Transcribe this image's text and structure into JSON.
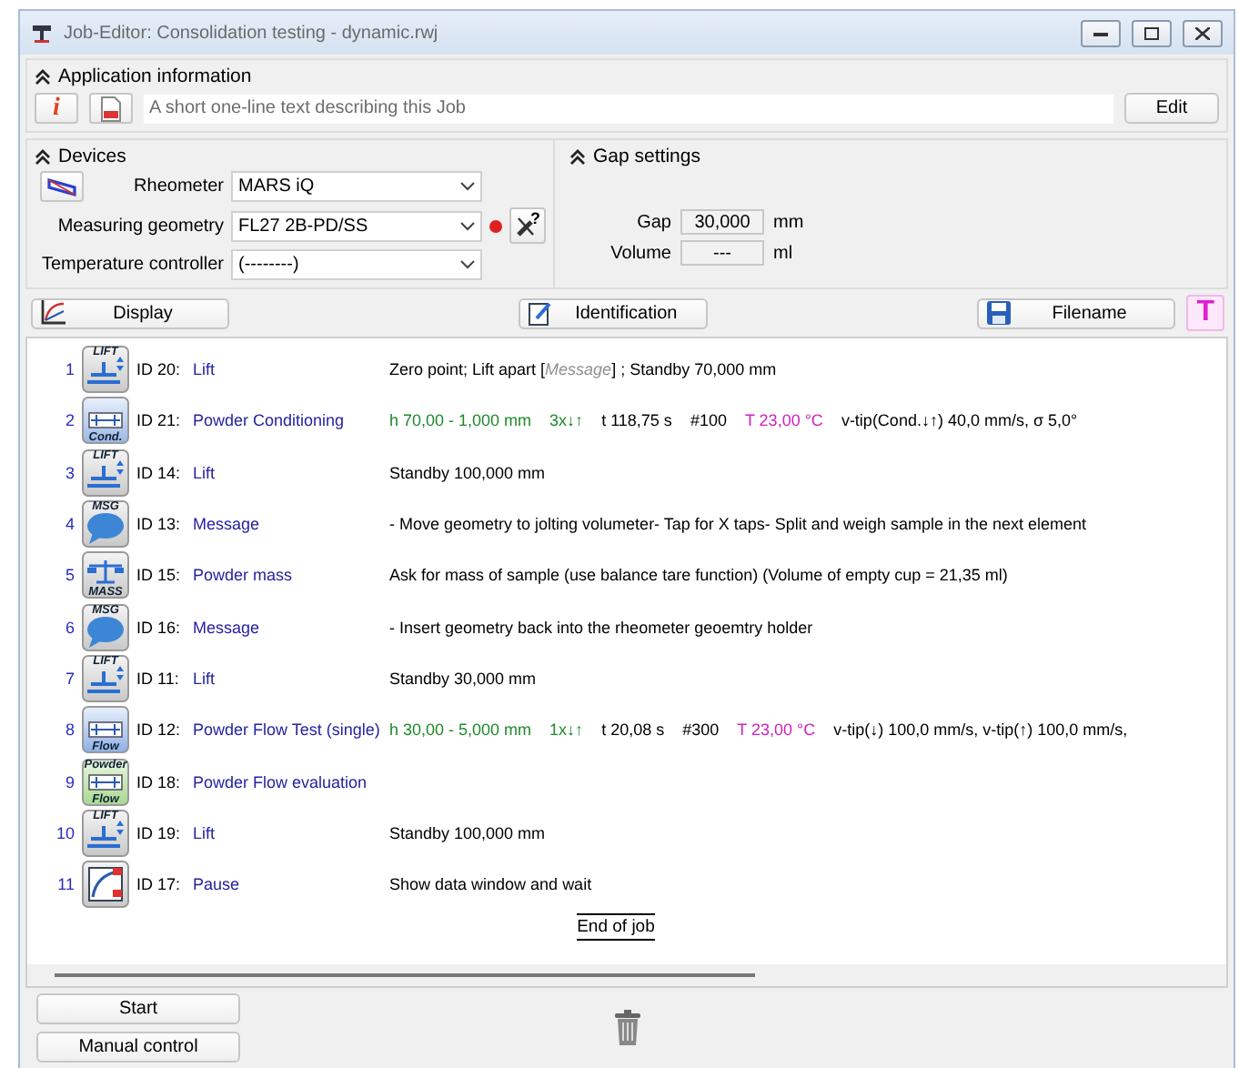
{
  "window": {
    "title": "Job-Editor: Consolidation testing - dynamic.rwj"
  },
  "application_information": {
    "header": "Application information",
    "info_button": "i",
    "description": "A short one-line text describing this Job",
    "edit_button": "Edit"
  },
  "devices": {
    "header": "Devices",
    "geometry_help_button": "?",
    "fields": [
      {
        "label": "Rheometer",
        "value": "MARS iQ"
      },
      {
        "label": "Measuring geometry",
        "value": "FL27 2B-PD/SS"
      },
      {
        "label": "Temperature controller",
        "value": "(--------)"
      }
    ]
  },
  "gap_settings": {
    "header": "Gap settings",
    "fields": [
      {
        "label": "Gap",
        "value": "30,000",
        "unit": "mm"
      },
      {
        "label": "Volume",
        "value": "---",
        "unit": "ml"
      }
    ]
  },
  "toolbar": {
    "buttons": [
      {
        "kind": "display",
        "label": "Display"
      },
      {
        "kind": "identification",
        "label": "Identification"
      },
      {
        "kind": "filename",
        "label": "Filename"
      }
    ],
    "font_button": "T"
  },
  "steps": [
    {
      "number": "1",
      "kind": "lift",
      "icon_text": [
        "LIFT"
      ],
      "id": "ID 20:",
      "name": "Lift",
      "details": [
        {
          "kind": "text",
          "text": "Zero point; Lift apart [",
          "color": "#000000"
        },
        {
          "kind": "hint",
          "text": "Message",
          "color": "#909090"
        },
        {
          "kind": "text",
          "text": "] ; Standby 70,000 mm",
          "color": "#000000"
        }
      ]
    },
    {
      "number": "2",
      "kind": "cond",
      "icon_text": [
        "Cond."
      ],
      "id": "ID 21:",
      "name": "Powder Conditioning",
      "details": [
        {
          "kind": "param",
          "text": "h 70,00 - 1,000 mm",
          "color": "#1e8a2a"
        },
        {
          "kind": "param",
          "text": "3x↓↑",
          "color": "#1e8a2a"
        },
        {
          "kind": "param",
          "text": "t 118,75 s",
          "color": "#000000"
        },
        {
          "kind": "param",
          "text": "#100",
          "color": "#000000"
        },
        {
          "kind": "param",
          "text": "T 23,00 °C",
          "color": "#d020c0"
        },
        {
          "kind": "param",
          "text": "v-tip(Cond.↓↑) 40,0 mm/s, σ 5,0°",
          "color": "#000000"
        }
      ]
    },
    {
      "number": "3",
      "kind": "lift",
      "icon_text": [
        "LIFT"
      ],
      "id": "ID 14:",
      "name": "Lift",
      "details": [
        {
          "kind": "text",
          "text": "Standby 100,000 mm",
          "color": "#000000"
        }
      ]
    },
    {
      "number": "4",
      "kind": "msg",
      "icon_text": [
        "MSG"
      ],
      "id": "ID 13:",
      "name": "Message",
      "details": [
        {
          "kind": "text",
          "text": "- Move geometry to jolting volumeter- Tap for X taps- Split and weigh sample in the next element",
          "color": "#000000"
        }
      ]
    },
    {
      "number": "5",
      "kind": "mass",
      "icon_text": [
        "MASS"
      ],
      "id": "ID 15:",
      "name": "Powder mass",
      "details": [
        {
          "kind": "text",
          "text": "Ask for mass of sample (use balance tare function)  (Volume of empty cup = 21,35 ml)",
          "color": "#000000"
        }
      ]
    },
    {
      "number": "6",
      "kind": "msg",
      "icon_text": [
        "MSG"
      ],
      "id": "ID 16:",
      "name": "Message",
      "details": [
        {
          "kind": "text",
          "text": "- Insert geometry back into the rheometer geoemtry holder",
          "color": "#000000"
        }
      ]
    },
    {
      "number": "7",
      "kind": "lift",
      "icon_text": [
        "LIFT"
      ],
      "id": "ID 11:",
      "name": "Lift",
      "details": [
        {
          "kind": "text",
          "text": "Standby 30,000 mm",
          "color": "#000000"
        }
      ]
    },
    {
      "number": "8",
      "kind": "flow",
      "icon_text": [
        "Flow"
      ],
      "id": "ID 12:",
      "name": "Powder Flow Test (single)",
      "details": [
        {
          "kind": "param",
          "text": "h 30,00 - 5,000 mm",
          "color": "#1e8a2a"
        },
        {
          "kind": "param",
          "text": "1x↓↑",
          "color": "#1e8a2a"
        },
        {
          "kind": "param",
          "text": "t 20,08 s",
          "color": "#000000"
        },
        {
          "kind": "param",
          "text": "#300",
          "color": "#000000"
        },
        {
          "kind": "param",
          "text": "T 23,00 °C",
          "color": "#d020c0"
        },
        {
          "kind": "param",
          "text": "v-tip(↓) 100,0 mm/s, v-tip(↑) 100,0 mm/s,",
          "color": "#000000"
        }
      ]
    },
    {
      "number": "9",
      "kind": "eval",
      "icon_text": [
        "Powder",
        "Flow"
      ],
      "id": "ID 18:",
      "name": "Powder Flow evaluation"
    },
    {
      "number": "10",
      "kind": "lift",
      "icon_text": [
        "LIFT"
      ],
      "id": "ID 19:",
      "name": "Lift",
      "details": [
        {
          "kind": "text",
          "text": "Standby 100,000 mm",
          "color": "#000000"
        }
      ]
    },
    {
      "number": "11",
      "kind": "pause",
      "id": "ID 17:",
      "name": "Pause",
      "details": [
        {
          "kind": "text",
          "text": "Show data window and wait",
          "color": "#000000"
        }
      ]
    }
  ],
  "end_label": "End of job",
  "bottom_buttons": [
    "Start",
    "Manual control"
  ]
}
